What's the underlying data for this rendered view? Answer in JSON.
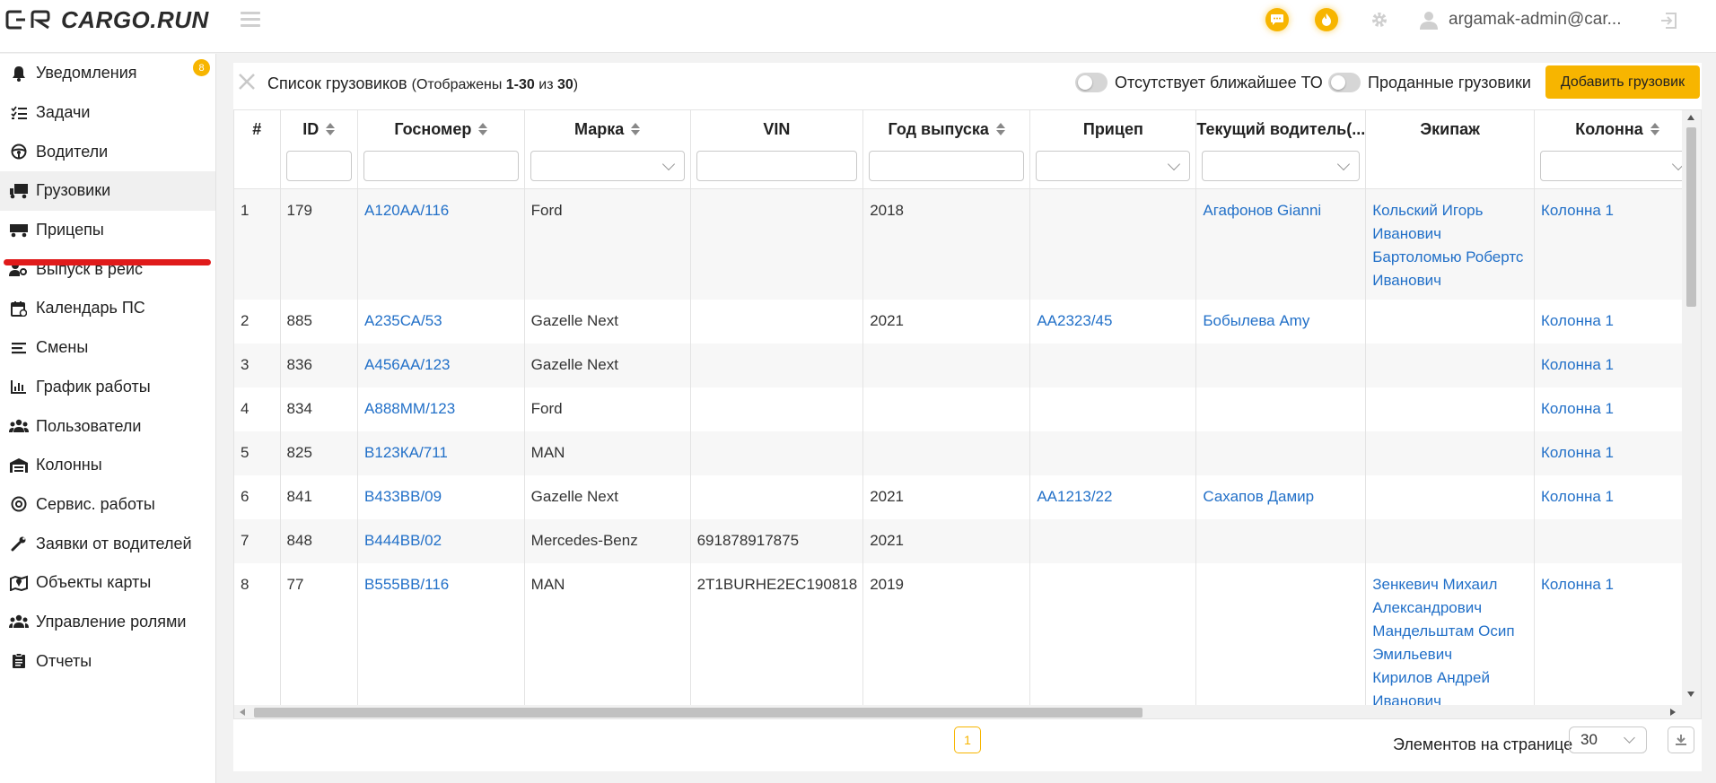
{
  "header": {
    "brand": "CARGO.RUN",
    "user": "argamak-admin@car..."
  },
  "sidebar": {
    "notification_count": "8",
    "items": [
      {
        "label": "Уведомления",
        "icon": "bell-icon"
      },
      {
        "label": "Задачи",
        "icon": "tasks-icon"
      },
      {
        "label": "Водители",
        "icon": "steering-wheel-icon"
      },
      {
        "label": "Грузовики",
        "icon": "truck-icon",
        "active": true
      },
      {
        "label": "Прицепы",
        "icon": "trailer-icon"
      },
      {
        "label": "Выпуск в рейс",
        "icon": "user-key-icon"
      },
      {
        "label": "Календарь ПС",
        "icon": "calendar-icon"
      },
      {
        "label": "Смены",
        "icon": "list-icon"
      },
      {
        "label": "График работы",
        "icon": "bar-chart-icon"
      },
      {
        "label": "Пользователи",
        "icon": "users-icon"
      },
      {
        "label": "Колонны",
        "icon": "warehouse-icon"
      },
      {
        "label": "Сервис. работы",
        "icon": "service-icon"
      },
      {
        "label": "Заявки от водителей",
        "icon": "wrench-icon"
      },
      {
        "label": "Объекты карты",
        "icon": "map-icon"
      },
      {
        "label": "Управление ролями",
        "icon": "users-cog-icon"
      },
      {
        "label": "Отчеты",
        "icon": "clipboard-icon"
      }
    ]
  },
  "toolbar": {
    "title": "Список грузовиков",
    "shown_prefix": "(Отображены ",
    "shown_range": "1-30",
    "shown_of": " из ",
    "shown_total": "30",
    "shown_suffix": ")",
    "toggle_no_to": "Отсутствует ближайшее ТО",
    "toggle_sold": "Проданные грузовики",
    "add_button": "Добавить грузовик"
  },
  "table": {
    "columns": [
      "#",
      "ID",
      "Госномер",
      "Марка",
      "VIN",
      "Год выпуска",
      "Прицеп",
      "Текущий водитель(...",
      "Экипаж",
      "Колонна"
    ],
    "rows": [
      {
        "n": "1",
        "id": "179",
        "plate": "А120АА/116",
        "brand": "Ford",
        "vin": "",
        "year": "2018",
        "trailer": "",
        "driver": "Агафонов Gianni",
        "crew": [
          "Кольский Игорь",
          "Иванович",
          "Бартоломью Робертс",
          "Иванович"
        ],
        "column": "Колонна 1"
      },
      {
        "n": "2",
        "id": "885",
        "plate": "А235СА/53",
        "brand": "Gazelle Next",
        "vin": "",
        "year": "2021",
        "trailer": "АА2323/45",
        "driver": "Бобылева Amy",
        "crew": [],
        "column": "Колонна 1"
      },
      {
        "n": "3",
        "id": "836",
        "plate": "А456АА/123",
        "brand": "Gazelle Next",
        "vin": "",
        "year": "",
        "trailer": "",
        "driver": "",
        "crew": [],
        "column": "Колонна 1"
      },
      {
        "n": "4",
        "id": "834",
        "plate": "А888ММ/123",
        "brand": "Ford",
        "vin": "",
        "year": "",
        "trailer": "",
        "driver": "",
        "crew": [],
        "column": "Колонна 1"
      },
      {
        "n": "5",
        "id": "825",
        "plate": "В123КА/711",
        "brand": "MAN",
        "vin": "",
        "year": "",
        "trailer": "",
        "driver": "",
        "crew": [],
        "column": "Колонна 1"
      },
      {
        "n": "6",
        "id": "841",
        "plate": "В433ВВ/09",
        "brand": "Gazelle Next",
        "vin": "",
        "year": "2021",
        "trailer": "АА1213/22",
        "driver": "Сахапов Дамир",
        "crew": [],
        "column": "Колонна 1"
      },
      {
        "n": "7",
        "id": "848",
        "plate": "В444ВВ/02",
        "brand": "Mercedes-Benz",
        "vin": "691878917875",
        "year": "2021",
        "trailer": "",
        "driver": "",
        "crew": [],
        "column": ""
      },
      {
        "n": "8",
        "id": "77",
        "plate": "В555ВВ/116",
        "brand": "MAN",
        "vin": "2T1BURHE2EC190818",
        "year": "2019",
        "trailer": "",
        "driver": "",
        "crew": [
          "Зенкевич Михаил",
          "Александрович",
          "Мандельштам Осип",
          "Эмильевич",
          "Кирилов Андрей",
          "Иванович"
        ],
        "column": "Колонна 1"
      }
    ]
  },
  "footer": {
    "current_page": "1",
    "per_page_label": "Элементов на странице",
    "per_page_value": "30"
  },
  "colors": {
    "accent": "#f7b500",
    "link": "#2270c8",
    "active_underline": "#e01b1b"
  }
}
